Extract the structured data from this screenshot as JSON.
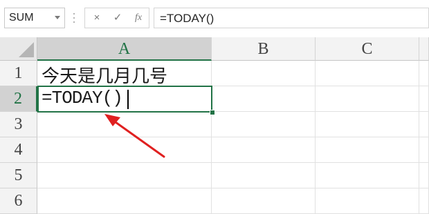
{
  "formula_bar": {
    "name_box": "SUM",
    "cancel_icon": "×",
    "enter_icon": "✓",
    "fx_label": "fx",
    "formula": "=TODAY()"
  },
  "sheet": {
    "columns": [
      "A",
      "B",
      "C"
    ],
    "rows": [
      "1",
      "2",
      "3",
      "4",
      "5",
      "6"
    ],
    "selected_column": "A",
    "selected_row": "2",
    "cells": {
      "A1": "今天是几月几号",
      "A2": "=TODAY()"
    }
  },
  "annotation": {
    "arrow_color": "#e02020"
  },
  "colors": {
    "selection_green": "#217346"
  }
}
